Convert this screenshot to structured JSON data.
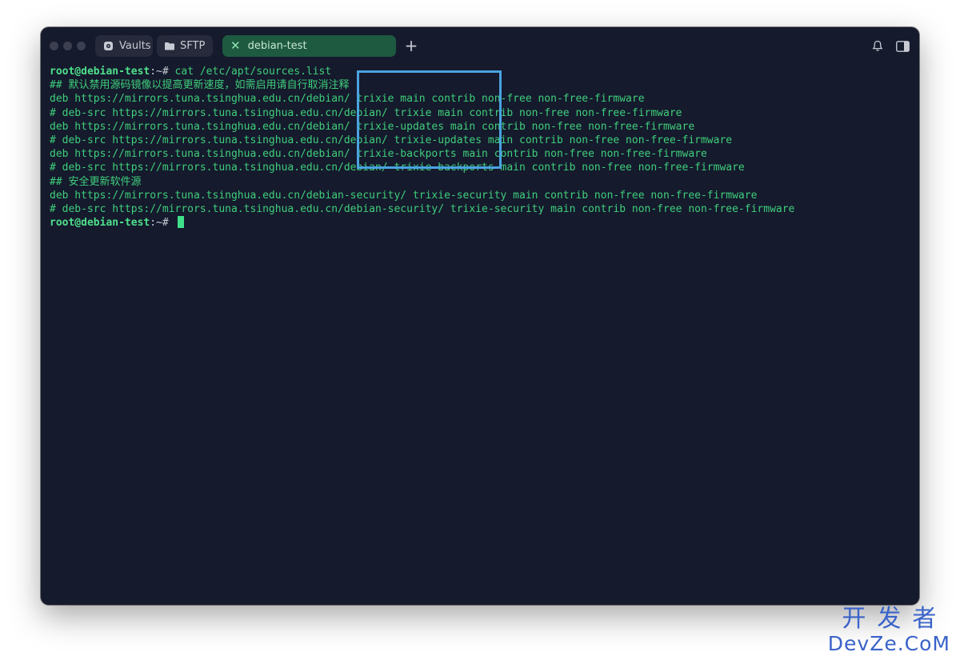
{
  "tabs": {
    "vaults_label": "Vaults",
    "sftp_label": "SFTP",
    "active_label": "debian-test",
    "new_tab_symbol": "+"
  },
  "terminal": {
    "prompt_user": "root@debian-test",
    "prompt_tail": ":~#",
    "lines": [
      {
        "kind": "prompt",
        "cmd": " cat /etc/apt/sources.list"
      },
      {
        "kind": "out",
        "text": "## 默认禁用源码镜像以提高更新速度，如需启用请自行取消注释"
      },
      {
        "kind": "out",
        "text": "deb https://mirrors.tuna.tsinghua.edu.cn/debian/ trixie main contrib non-free non-free-firmware"
      },
      {
        "kind": "out",
        "text": "# deb-src https://mirrors.tuna.tsinghua.edu.cn/debian/ trixie main contrib non-free non-free-firmware"
      },
      {
        "kind": "out",
        "text": "deb https://mirrors.tuna.tsinghua.edu.cn/debian/ trixie-updates main contrib non-free non-free-firmware"
      },
      {
        "kind": "out",
        "text": "# deb-src https://mirrors.tuna.tsinghua.edu.cn/debian/ trixie-updates main contrib non-free non-free-firmware"
      },
      {
        "kind": "out",
        "text": "deb https://mirrors.tuna.tsinghua.edu.cn/debian/ trixie-backports main contrib non-free non-free-firmware"
      },
      {
        "kind": "out",
        "text": "# deb-src https://mirrors.tuna.tsinghua.edu.cn/debian/ trixie-backports main contrib non-free non-free-firmware"
      },
      {
        "kind": "out",
        "text": "## 安全更新软件源"
      },
      {
        "kind": "out",
        "text": "deb https://mirrors.tuna.tsinghua.edu.cn/debian-security/ trixie-security main contrib non-free non-free-firmware"
      },
      {
        "kind": "out",
        "text": "# deb-src https://mirrors.tuna.tsinghua.edu.cn/debian-security/ trixie-security main contrib non-free non-free-firmware"
      },
      {
        "kind": "prompt",
        "cmd": " "
      }
    ]
  },
  "watermark": {
    "cn": "开发者",
    "en": "DevZe.CoM"
  },
  "colors": {
    "terminal_bg": "#151a2d",
    "text_green": "#3fcf7a",
    "active_tab": "#1e5a40",
    "highlight_blue": "#4aa3e0"
  },
  "icons": {
    "vaults": "vault-icon",
    "sftp": "folder-icon",
    "active_close": "close-icon",
    "bell": "bell-icon",
    "sidebar": "sidebar-toggle-icon"
  }
}
